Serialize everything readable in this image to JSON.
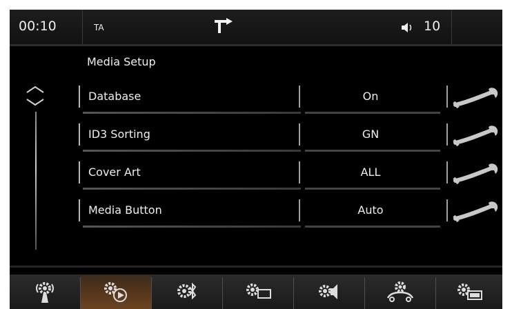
{
  "status_bar": {
    "time": "00:10",
    "ta_label": "TA",
    "volume": "10",
    "nav_icon": "navigation-turn-icon",
    "volume_icon": "speaker-icon"
  },
  "menu": {
    "title": "Media Setup",
    "items": [
      {
        "label": "Database",
        "value": "On"
      },
      {
        "label": "ID3 Sorting",
        "value": "GN"
      },
      {
        "label": "Cover Art",
        "value": "ALL"
      },
      {
        "label": "Media Button",
        "value": "Auto"
      }
    ]
  },
  "tabs": [
    {
      "name": "connectivity-settings",
      "icon": "gear-antenna-icon"
    },
    {
      "name": "media-settings",
      "icon": "gear-play-icon",
      "active": true
    },
    {
      "name": "bluetooth-settings",
      "icon": "gear-bluetooth-icon"
    },
    {
      "name": "display-settings",
      "icon": "gear-screen-icon"
    },
    {
      "name": "audio-settings",
      "icon": "gear-speaker-icon"
    },
    {
      "name": "vehicle-settings",
      "icon": "gear-car-icon"
    },
    {
      "name": "system-settings",
      "icon": "gear-device-icon"
    }
  ],
  "colors": {
    "background": "#000000",
    "text": "#eeeeee",
    "active_tab": "#6b4321"
  }
}
